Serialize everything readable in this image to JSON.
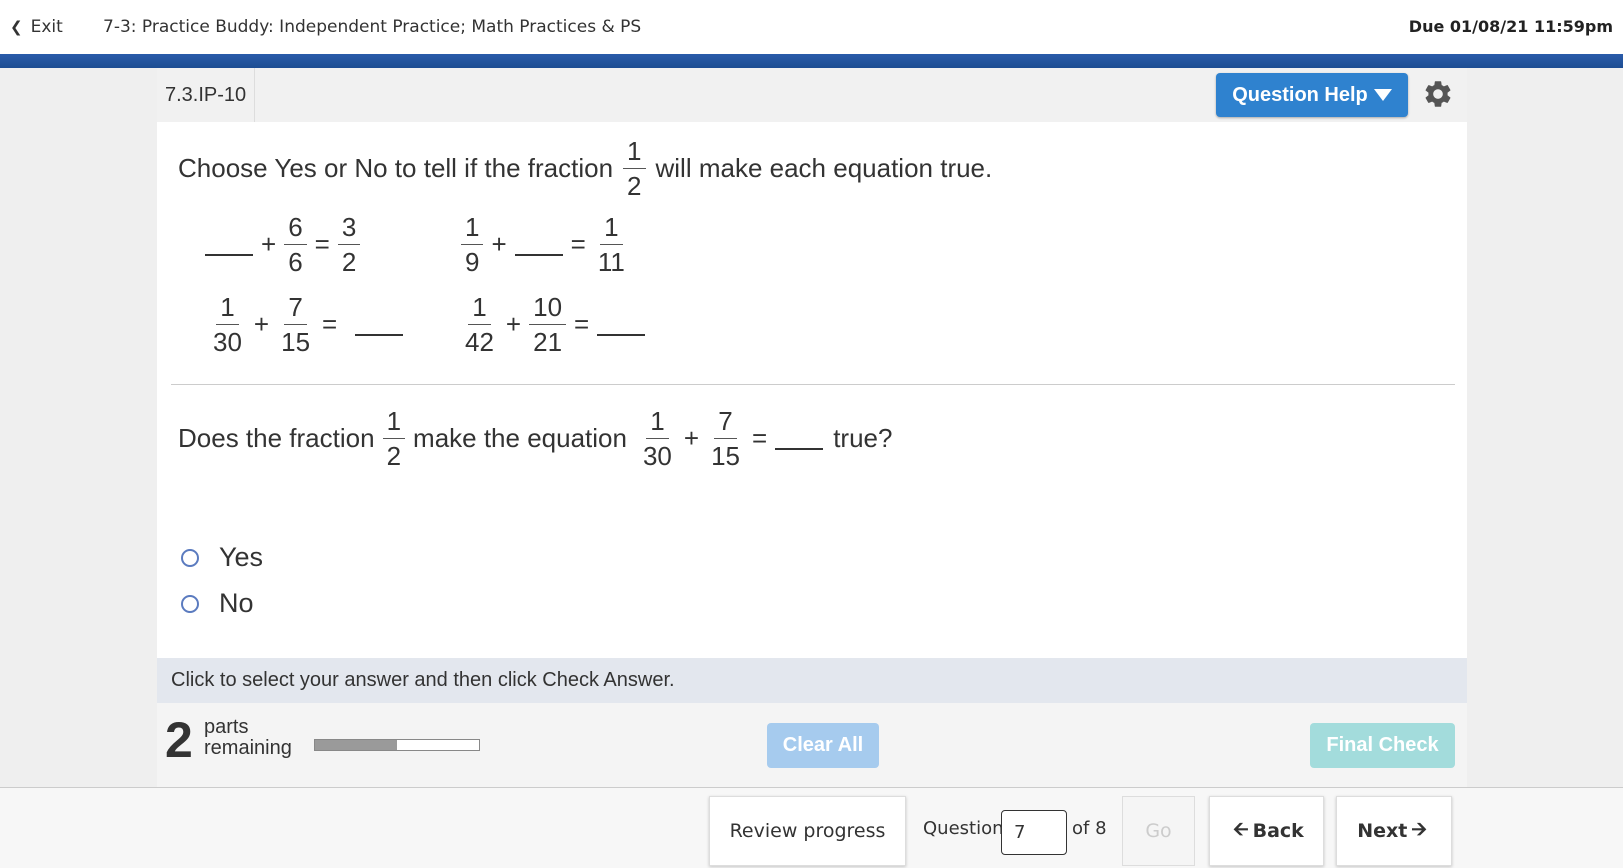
{
  "topbar": {
    "exit_label": "Exit",
    "assignment_title": "7-3: Practice Buddy: Independent Practice; Math Practices & PS",
    "due": "Due 01/08/21 11:59pm"
  },
  "panel": {
    "question_id": "7.3.IP-10",
    "help_label": "Question Help",
    "icons": [
      "chevron-left-icon",
      "caret-down-icon",
      "gear-icon",
      "arrow-left-icon",
      "arrow-right-icon"
    ]
  },
  "problem": {
    "instruction_pre": "Choose Yes or No to tell if the fraction",
    "instruction_frac": {
      "num": "1",
      "den": "2"
    },
    "instruction_post": "will make each equation true.",
    "equations": {
      "eq1": {
        "f1": {
          "num": "6",
          "den": "6"
        },
        "f2": {
          "num": "3",
          "den": "2"
        }
      },
      "eq2": {
        "f1": {
          "num": "1",
          "den": "9"
        },
        "f2": {
          "num": "1",
          "den": "11"
        }
      },
      "eq3": {
        "f1": {
          "num": "1",
          "den": "30"
        },
        "f2": {
          "num": "7",
          "den": "15"
        }
      },
      "eq4": {
        "f1": {
          "num": "1",
          "den": "42"
        },
        "f2": {
          "num": "10",
          "den": "21"
        }
      }
    },
    "symbols": {
      "plus": "+",
      "equals": "="
    }
  },
  "question": {
    "pre": "Does the fraction",
    "frac": {
      "num": "1",
      "den": "2"
    },
    "mid": "make the equation",
    "eq_f1": {
      "num": "1",
      "den": "30"
    },
    "eq_f2": {
      "num": "7",
      "den": "15"
    },
    "post": "true?",
    "options": [
      {
        "label": "Yes",
        "selected": false
      },
      {
        "label": "No",
        "selected": false
      }
    ]
  },
  "hint": "Click to select your answer and then click Check Answer.",
  "progress": {
    "parts_count": "2",
    "parts_word": "parts",
    "remaining_word": "remaining",
    "fraction_complete": 0.5
  },
  "buttons": {
    "clear_all": "Clear All",
    "final_check": "Final Check"
  },
  "nav": {
    "review_progress": "Review progress",
    "question_label": "Question",
    "question_value": "7",
    "of_label": "of 8",
    "go": "Go",
    "back": "Back",
    "next": "Next"
  },
  "colors": {
    "brand_blue": "#2f82cf",
    "stripe_blue": "#1d4d92",
    "clear_disabled": "#a6cbee",
    "final_disabled": "#a3dcdc"
  }
}
